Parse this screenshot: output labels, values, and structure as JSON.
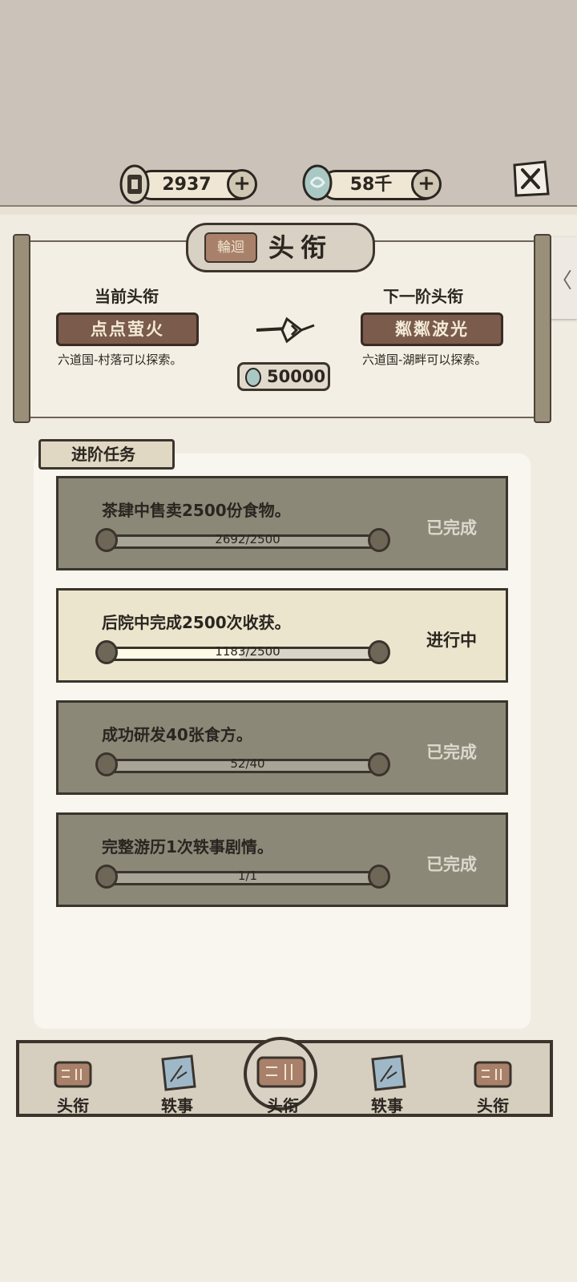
{
  "currency": {
    "coins": "2937",
    "jade": "58千",
    "plus": "+"
  },
  "title": {
    "seal_text": "輪迴",
    "heading": "头衔",
    "current_label": "当前头衔",
    "next_label": "下一阶头衔",
    "current_rank": "点点萤火",
    "next_rank": "粼粼波光",
    "current_desc": "六道国-村落可以探索。",
    "next_desc": "六道国-湖畔可以探索。",
    "cost": "50000"
  },
  "tasks": {
    "section_title": "进阶任务",
    "items": [
      {
        "desc": "茶肆中售卖2500份食物。",
        "progress": "2692/2500",
        "fraction": 1.0,
        "status": "已完成"
      },
      {
        "desc": "后院中完成2500次收获。",
        "progress": "1183/2500",
        "fraction": 0.473,
        "status": "进行中"
      },
      {
        "desc": "成功研发40张食方。",
        "progress": "52/40",
        "fraction": 1.0,
        "status": "已完成"
      },
      {
        "desc": "完整游历1次轶事剧情。",
        "progress": "1/1",
        "fraction": 1.0,
        "status": "已完成"
      }
    ]
  },
  "nav": {
    "items": [
      {
        "label": "头衔"
      },
      {
        "label": "轶事"
      },
      {
        "label": "头衔"
      },
      {
        "label": "轶事"
      },
      {
        "label": "头衔"
      }
    ]
  },
  "side_tab": "〈",
  "colors": {
    "top_band": "#cbc3b9",
    "page": "#f1ece2",
    "task_done": "#8c8878",
    "task_active": "#ebe5cd",
    "rank_plate": "#7b5b4b"
  }
}
